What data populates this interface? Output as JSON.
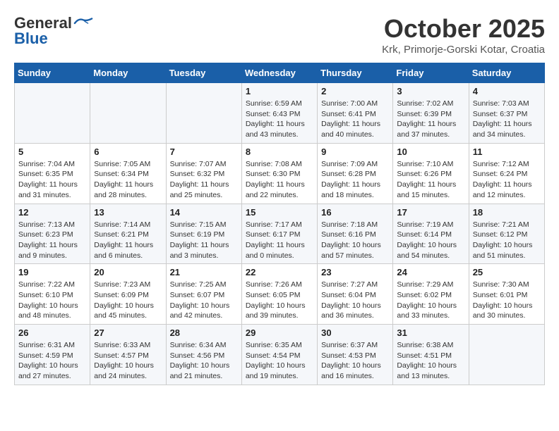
{
  "header": {
    "logo_general": "General",
    "logo_blue": "Blue",
    "month_title": "October 2025",
    "location": "Krk, Primorje-Gorski Kotar, Croatia"
  },
  "weekdays": [
    "Sunday",
    "Monday",
    "Tuesday",
    "Wednesday",
    "Thursday",
    "Friday",
    "Saturday"
  ],
  "weeks": [
    [
      {
        "day": "",
        "info": ""
      },
      {
        "day": "",
        "info": ""
      },
      {
        "day": "",
        "info": ""
      },
      {
        "day": "1",
        "info": "Sunrise: 6:59 AM\nSunset: 6:43 PM\nDaylight: 11 hours\nand 43 minutes."
      },
      {
        "day": "2",
        "info": "Sunrise: 7:00 AM\nSunset: 6:41 PM\nDaylight: 11 hours\nand 40 minutes."
      },
      {
        "day": "3",
        "info": "Sunrise: 7:02 AM\nSunset: 6:39 PM\nDaylight: 11 hours\nand 37 minutes."
      },
      {
        "day": "4",
        "info": "Sunrise: 7:03 AM\nSunset: 6:37 PM\nDaylight: 11 hours\nand 34 minutes."
      }
    ],
    [
      {
        "day": "5",
        "info": "Sunrise: 7:04 AM\nSunset: 6:35 PM\nDaylight: 11 hours\nand 31 minutes."
      },
      {
        "day": "6",
        "info": "Sunrise: 7:05 AM\nSunset: 6:34 PM\nDaylight: 11 hours\nand 28 minutes."
      },
      {
        "day": "7",
        "info": "Sunrise: 7:07 AM\nSunset: 6:32 PM\nDaylight: 11 hours\nand 25 minutes."
      },
      {
        "day": "8",
        "info": "Sunrise: 7:08 AM\nSunset: 6:30 PM\nDaylight: 11 hours\nand 22 minutes."
      },
      {
        "day": "9",
        "info": "Sunrise: 7:09 AM\nSunset: 6:28 PM\nDaylight: 11 hours\nand 18 minutes."
      },
      {
        "day": "10",
        "info": "Sunrise: 7:10 AM\nSunset: 6:26 PM\nDaylight: 11 hours\nand 15 minutes."
      },
      {
        "day": "11",
        "info": "Sunrise: 7:12 AM\nSunset: 6:24 PM\nDaylight: 11 hours\nand 12 minutes."
      }
    ],
    [
      {
        "day": "12",
        "info": "Sunrise: 7:13 AM\nSunset: 6:23 PM\nDaylight: 11 hours\nand 9 minutes."
      },
      {
        "day": "13",
        "info": "Sunrise: 7:14 AM\nSunset: 6:21 PM\nDaylight: 11 hours\nand 6 minutes."
      },
      {
        "day": "14",
        "info": "Sunrise: 7:15 AM\nSunset: 6:19 PM\nDaylight: 11 hours\nand 3 minutes."
      },
      {
        "day": "15",
        "info": "Sunrise: 7:17 AM\nSunset: 6:17 PM\nDaylight: 11 hours\nand 0 minutes."
      },
      {
        "day": "16",
        "info": "Sunrise: 7:18 AM\nSunset: 6:16 PM\nDaylight: 10 hours\nand 57 minutes."
      },
      {
        "day": "17",
        "info": "Sunrise: 7:19 AM\nSunset: 6:14 PM\nDaylight: 10 hours\nand 54 minutes."
      },
      {
        "day": "18",
        "info": "Sunrise: 7:21 AM\nSunset: 6:12 PM\nDaylight: 10 hours\nand 51 minutes."
      }
    ],
    [
      {
        "day": "19",
        "info": "Sunrise: 7:22 AM\nSunset: 6:10 PM\nDaylight: 10 hours\nand 48 minutes."
      },
      {
        "day": "20",
        "info": "Sunrise: 7:23 AM\nSunset: 6:09 PM\nDaylight: 10 hours\nand 45 minutes."
      },
      {
        "day": "21",
        "info": "Sunrise: 7:25 AM\nSunset: 6:07 PM\nDaylight: 10 hours\nand 42 minutes."
      },
      {
        "day": "22",
        "info": "Sunrise: 7:26 AM\nSunset: 6:05 PM\nDaylight: 10 hours\nand 39 minutes."
      },
      {
        "day": "23",
        "info": "Sunrise: 7:27 AM\nSunset: 6:04 PM\nDaylight: 10 hours\nand 36 minutes."
      },
      {
        "day": "24",
        "info": "Sunrise: 7:29 AM\nSunset: 6:02 PM\nDaylight: 10 hours\nand 33 minutes."
      },
      {
        "day": "25",
        "info": "Sunrise: 7:30 AM\nSunset: 6:01 PM\nDaylight: 10 hours\nand 30 minutes."
      }
    ],
    [
      {
        "day": "26",
        "info": "Sunrise: 6:31 AM\nSunset: 4:59 PM\nDaylight: 10 hours\nand 27 minutes."
      },
      {
        "day": "27",
        "info": "Sunrise: 6:33 AM\nSunset: 4:57 PM\nDaylight: 10 hours\nand 24 minutes."
      },
      {
        "day": "28",
        "info": "Sunrise: 6:34 AM\nSunset: 4:56 PM\nDaylight: 10 hours\nand 21 minutes."
      },
      {
        "day": "29",
        "info": "Sunrise: 6:35 AM\nSunset: 4:54 PM\nDaylight: 10 hours\nand 19 minutes."
      },
      {
        "day": "30",
        "info": "Sunrise: 6:37 AM\nSunset: 4:53 PM\nDaylight: 10 hours\nand 16 minutes."
      },
      {
        "day": "31",
        "info": "Sunrise: 6:38 AM\nSunset: 4:51 PM\nDaylight: 10 hours\nand 13 minutes."
      },
      {
        "day": "",
        "info": ""
      }
    ]
  ]
}
